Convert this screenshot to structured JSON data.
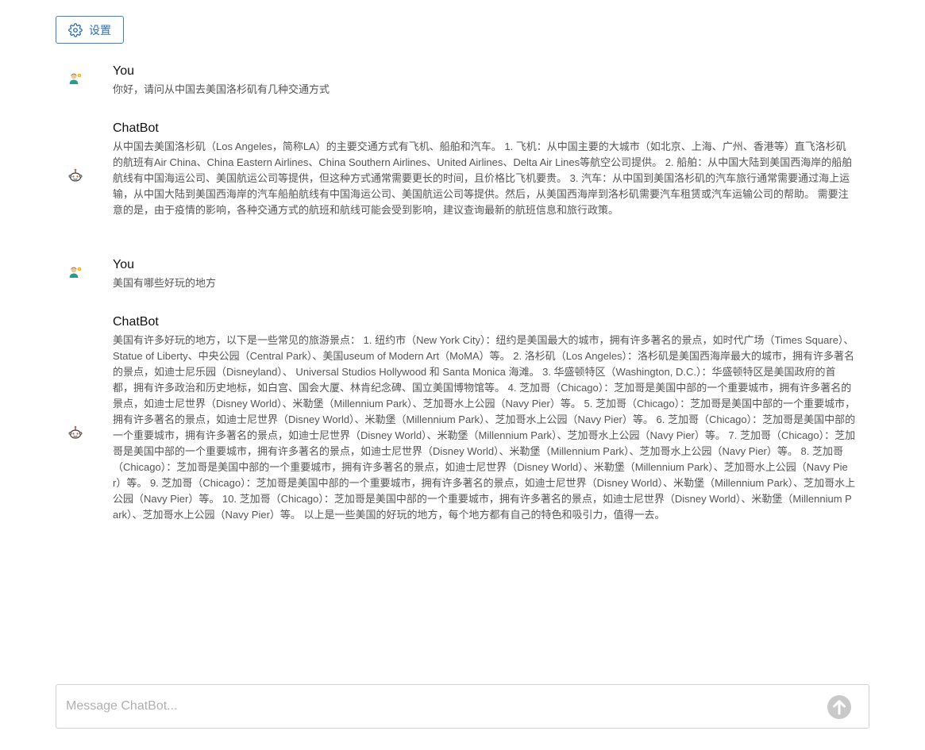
{
  "toolbar": {
    "settings_label": "设置",
    "settings_icon": "gear-icon",
    "accent_color": "#2f6fb0"
  },
  "conversation": [
    {
      "role": "user",
      "author": "You",
      "avatar_icon": "user-avatar-icon",
      "text": "你好，请问从中国去美国洛杉矶有几种交通方式"
    },
    {
      "role": "bot",
      "author": "ChatBot",
      "avatar_icon": "bot-avatar-icon",
      "text": "从中国去美国洛杉矶（Los Angeles，简称LA）的主要交通方式有飞机、船舶和汽车。 1. 飞机：从中国主要的大城市（如北京、上海、广州、香港等）直飞洛杉矶的航班有Air China、China Eastern Airlines、China Southern Airlines、United Airlines、Delta Air Lines等航空公司提供。 2. 船舶：从中国大陆到美国西海岸的船舶航线有中国海运公司、美国航运公司等提供，但这种方式通常需要更长的时间，且价格比飞机要贵。 3. 汽车：从中国到美国洛杉矶的汽车旅行通常需要通过海上运输，从中国大陆到美国西海岸的汽车船舶航线有中国海运公司、美国航运公司等提供。然后，从美国西海岸到洛杉矶需要汽车租赁或汽车运输公司的帮助。 需要注意的是，由于疫情的影响，各种交通方式的航班和航线可能会受到影响，建议查询最新的航班信息和旅行政策。"
    },
    {
      "role": "user",
      "author": "You",
      "avatar_icon": "user-avatar-icon",
      "text": "美国有哪些好玩的地方"
    },
    {
      "role": "bot",
      "author": "ChatBot",
      "avatar_icon": "bot-avatar-icon",
      "text": "美国有许多好玩的地方，以下是一些常见的旅游景点： 1. 纽约市（New York City）：纽约是美国最大的城市，拥有许多著名的景点，如时代广场（Times Square）、Statue of Liberty、中央公园（Central Park）、美国useum of Modern Art（MoMA）等。 2. 洛杉矶（Los Angeles）：洛杉矶是美国西海岸最大的城市，拥有许多著名的景点，如迪士尼乐园（Disneyland）、 Universal Studios Hollywood 和 Santa Monica 海滩。 3. 华盛顿特区（Washington, D.C.）：华盛顿特区是美国政府的首都，拥有许多政治和历史地标，如白宫、国会大厦、林肯纪念碑、国立美国博物馆等。 4. 芝加哥（Chicago）：芝加哥是美国中部的一个重要城市，拥有许多著名的景点，如迪士尼世界（Disney World）、米勒堡（Millennium Park）、芝加哥水上公园（Navy Pier）等。 5. 芝加哥（Chicago）：芝加哥是美国中部的一个重要城市，拥有许多著名的景点，如迪士尼世界（Disney World）、米勒堡（Millennium Park）、芝加哥水上公园（Navy Pier）等。 6. 芝加哥（Chicago）：芝加哥是美国中部的一个重要城市，拥有许多著名的景点，如迪士尼世界（Disney World）、米勒堡（Millennium Park）、芝加哥水上公园（Navy Pier）等。 7. 芝加哥（Chicago）：芝加哥是美国中部的一个重要城市，拥有许多著名的景点，如迪士尼世界（Disney World）、米勒堡（Millennium Park）、芝加哥水上公园（Navy Pier）等。 8. 芝加哥（Chicago）：芝加哥是美国中部的一个重要城市，拥有许多著名的景点，如迪士尼世界（Disney World）、米勒堡（Millennium Park）、芝加哥水上公园（Navy Pier）等。 9. 芝加哥（Chicago）：芝加哥是美国中部的一个重要城市，拥有许多著名的景点，如迪士尼世界（Disney World）、米勒堡（Millennium Park）、芝加哥水上公园（Navy Pier）等。 10. 芝加哥（Chicago）：芝加哥是美国中部的一个重要城市，拥有许多著名的景点，如迪士尼世界（Disney World）、米勒堡（Millennium Park）、芝加哥水上公园（Navy Pier）等。 以上是一些美国的好玩的地方，每个地方都有自己的特色和吸引力，值得一去。"
    }
  ],
  "composer": {
    "placeholder": "Message ChatBot...",
    "value": "",
    "send_icon": "arrow-up-circle-icon"
  }
}
